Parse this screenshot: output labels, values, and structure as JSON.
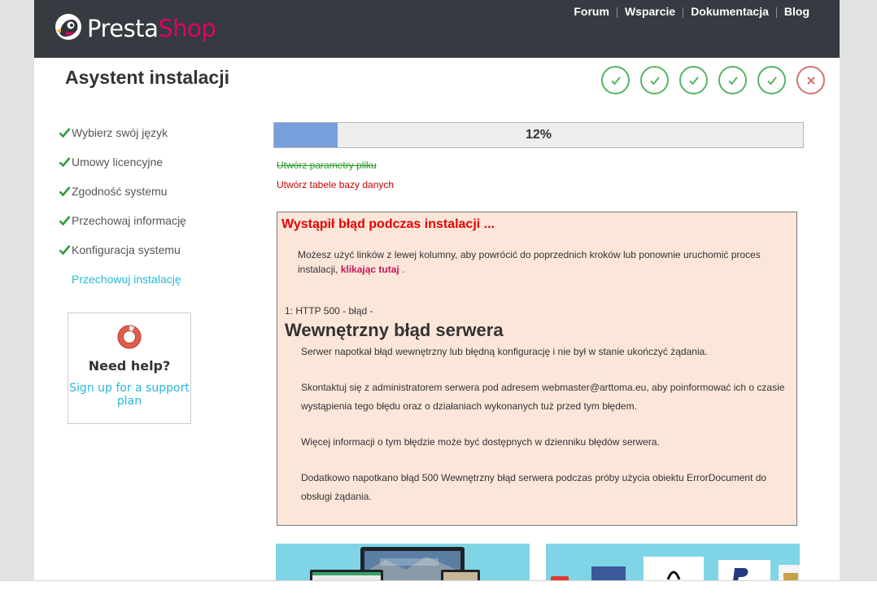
{
  "header": {
    "brand_part1": "Presta",
    "brand_part2": "Shop",
    "nav": [
      "Forum",
      "Wsparcie",
      "Dokumentacja",
      "Blog"
    ]
  },
  "page_title": "Asystent instalacji",
  "steps": [
    {
      "status": "done"
    },
    {
      "status": "done"
    },
    {
      "status": "done"
    },
    {
      "status": "done"
    },
    {
      "status": "done"
    },
    {
      "status": "error"
    }
  ],
  "sidebar": {
    "items": [
      {
        "label": "Wybierz swój język"
      },
      {
        "label": "Umowy licencyjne"
      },
      {
        "label": "Zgodność systemu"
      },
      {
        "label": "Przechowaj informację"
      },
      {
        "label": "Konfiguracja systemu"
      }
    ],
    "current": "Przechowuj instalację"
  },
  "help": {
    "title": "Need help?",
    "link": "Sign up for a support plan"
  },
  "progress": {
    "percent": 12,
    "label": "12%"
  },
  "tasks": {
    "done": "Utwórz parametry pliku",
    "failed": "Utwórz tabele bazy danych"
  },
  "error": {
    "title": "Wystąpił błąd podczas instalacji ...",
    "intro": "Możesz użyć linków z lewej kolumny, aby powrócić do poprzednich kroków lub ponownie uruchomić proces instalacji,",
    "retry_link": "klikając tutaj",
    "intro_end": ".",
    "code": "1: HTTP 500 - błąd -",
    "heading": "Wewnętrzny błąd serwera",
    "paragraphs": [
      "Serwer napotkał błąd wewnętrzny lub błędną konfigurację i nie był w stanie ukończyć żądania.",
      "Skontaktuj się z administratorem serwera pod adresem webmaster@arttoma.eu, aby poinformować ich o czasie wystąpienia tego błędu oraz o działaniach wykonanych tuż przed tym błędem.",
      "Więcej informacji o tym błędzie może być dostępnych w dzienniku błędów serwera.",
      "Dodatkowo napotkano błąd 500 Wewnętrzny błąd serwera podczas próby użycia obiektu ErrorDocument do obsługi żądania."
    ]
  },
  "colors": {
    "header_bg": "#363a41",
    "brand_pink": "#df0067",
    "success": "#56b562",
    "error_circle": "#d07373",
    "link_blue": "#25b9d7",
    "progress_fill": "#779fdc",
    "error_box_bg": "#fce6d9"
  }
}
